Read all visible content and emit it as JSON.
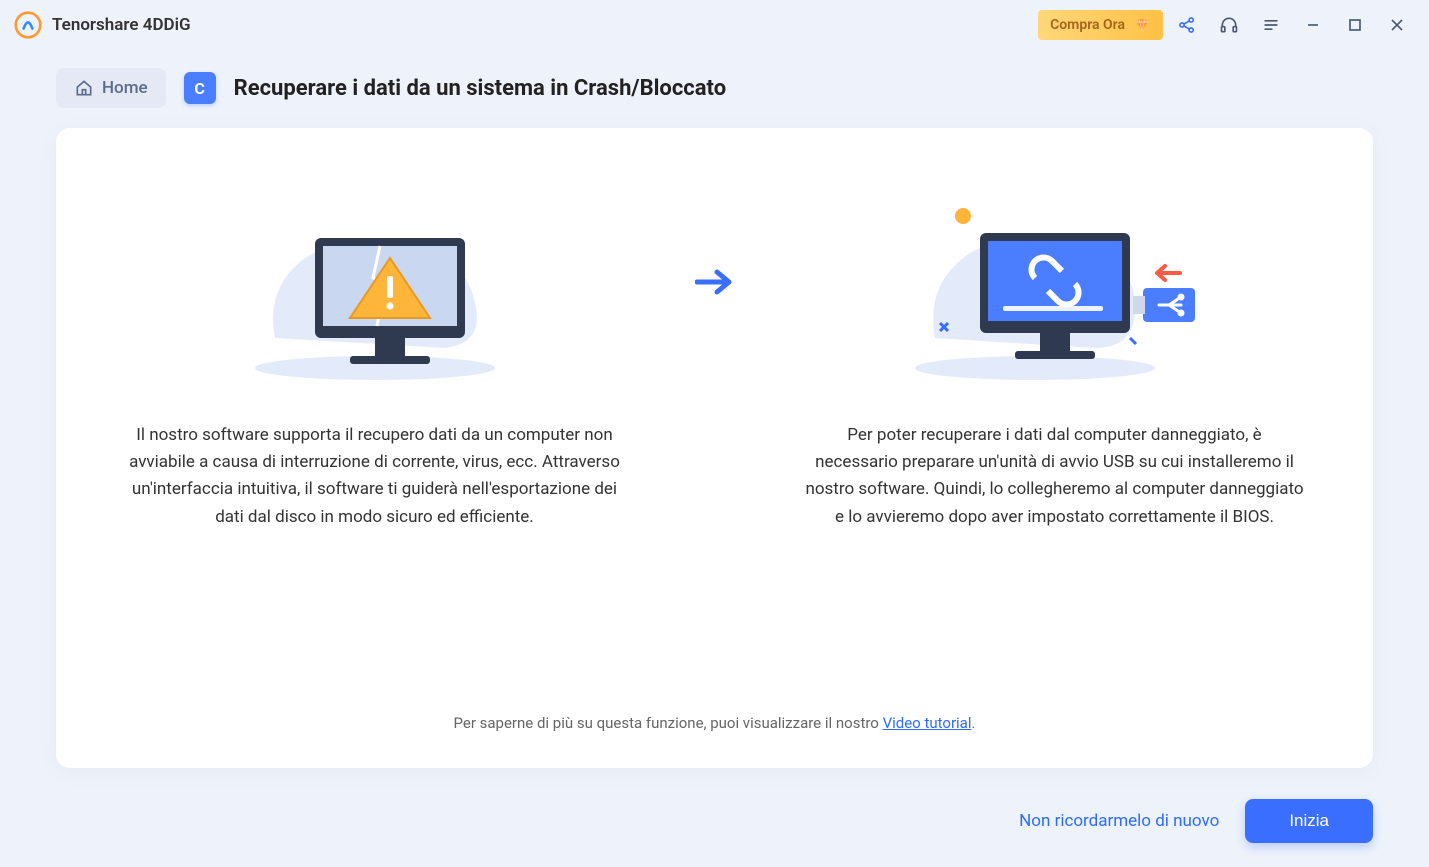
{
  "app": {
    "title": "Tenorshare 4DDiG"
  },
  "titlebar": {
    "buy_label": "Compra Ora"
  },
  "breadcrumb": {
    "home_label": "Home",
    "icon_letter": "C",
    "page_title": "Recuperare i dati da un sistema in Crash/Bloccato"
  },
  "content": {
    "left_desc": "Il nostro software supporta il recupero dati da un computer non avviabile a causa di interruzione di corrente, virus, ecc. Attraverso un'interfaccia intuitiva, il software ti guiderà nell'esportazione dei dati dal disco in modo sicuro ed efficiente.",
    "right_desc": "Per poter recuperare i dati dal computer danneggiato, è necessario preparare un'unità di avvio USB su cui installeremo il nostro software. Quindi, lo collegheremo al computer danneggiato e lo avvieremo dopo aver impostato correttamente il BIOS."
  },
  "tutorial": {
    "prefix": "Per saperne di più su questa funzione, puoi visualizzare il nostro ",
    "link": "Video tutorial",
    "suffix": "."
  },
  "footer": {
    "dont_remind": "Non ricordarmelo di nuovo",
    "start": "Inizia"
  }
}
